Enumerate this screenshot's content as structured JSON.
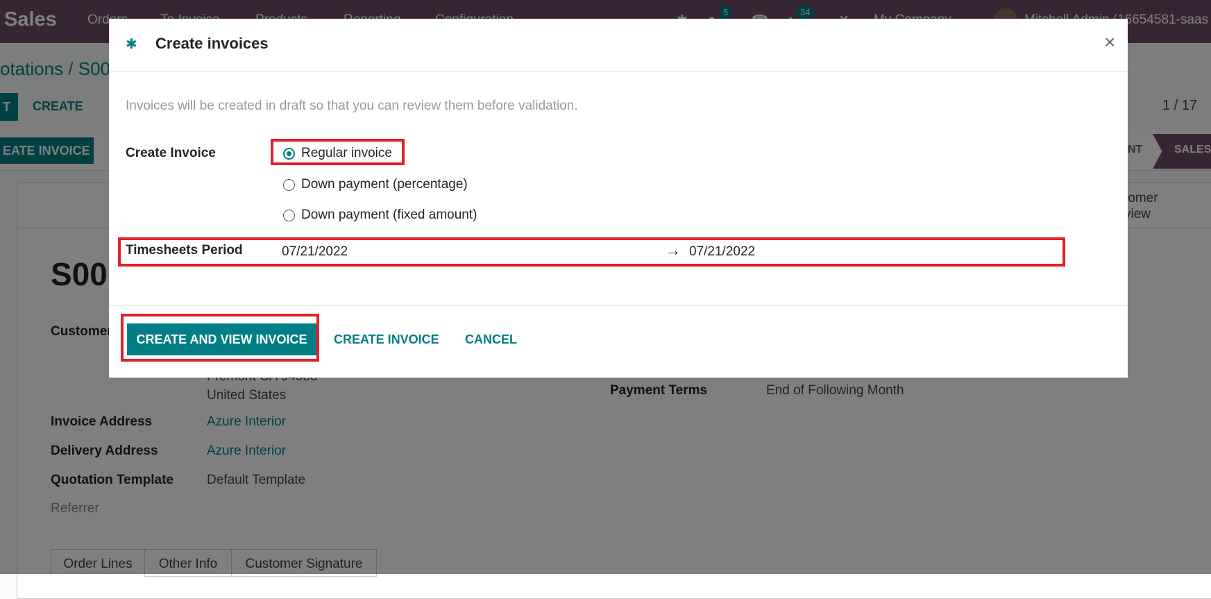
{
  "navbar": {
    "app": "Sales",
    "menu": [
      "Orders",
      "To Invoice",
      "Products",
      "Reporting",
      "Configuration"
    ],
    "chat_count": "5",
    "activity_count": "34",
    "company": "My Company",
    "user": "Mitchell Admin (16654581-saas"
  },
  "breadcrumb": "otations / S00",
  "control": {
    "edit": "T",
    "create": "CREATE",
    "pager": "1 / 17"
  },
  "statusbar": {
    "create_invoice": "EATE INVOICE",
    "stage_partial": "NT",
    "stage_sales": "SALES"
  },
  "sheet": {
    "smart_button": [
      "tomer",
      "view"
    ],
    "name": "S00",
    "customer_label": "Customer",
    "address_line": "Fremont CA 94538",
    "country": "United States",
    "invoice_address_label": "Invoice Address",
    "invoice_address": "Azure Interior",
    "delivery_address_label": "Delivery Address",
    "delivery_address": "Azure Interior",
    "template_label": "Quotation Template",
    "template": "Default Template",
    "referrer_label": "Referrer",
    "payment_terms_label": "Payment Terms",
    "payment_terms": "End of Following Month",
    "tabs": [
      "Order Lines",
      "Other Info",
      "Customer Signature"
    ]
  },
  "modal": {
    "title": "Create invoices",
    "close": "×",
    "description": "Invoices will be created in draft so that you can review them before validation.",
    "create_invoice_label": "Create Invoice",
    "options": [
      {
        "label": "Regular invoice",
        "selected": true
      },
      {
        "label": "Down payment (percentage)",
        "selected": false
      },
      {
        "label": "Down payment (fixed amount)",
        "selected": false
      }
    ],
    "timesheets_label": "Timesheets Period",
    "date_from": "07/21/2022",
    "arrow": "→",
    "date_to": "07/21/2022",
    "buttons": {
      "create_view": "CREATE AND VIEW INVOICE",
      "create": "CREATE INVOICE",
      "cancel": "CANCEL"
    }
  },
  "colors": {
    "primary": "#017e84",
    "brand": "#714b67",
    "highlight": "#e3202a"
  }
}
